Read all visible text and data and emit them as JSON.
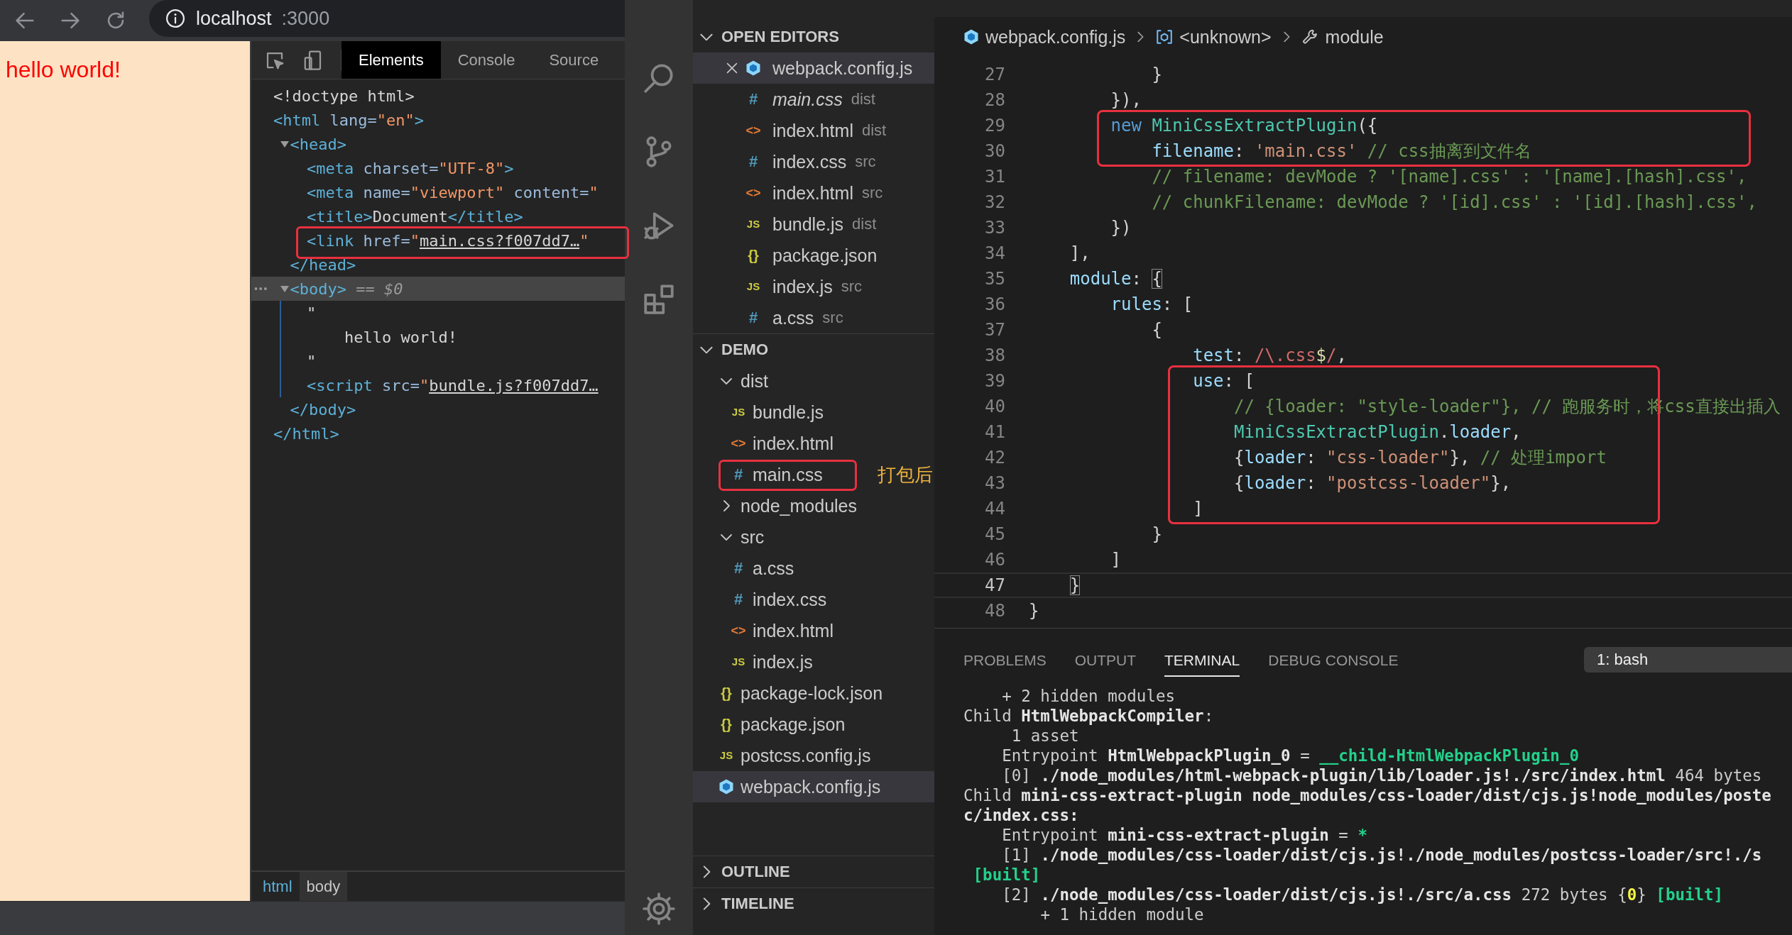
{
  "browser": {
    "address": {
      "host": "localhost",
      "port": ":3000"
    },
    "page_text": "hello world!",
    "devtools": {
      "tabs": [
        {
          "label": "Elements",
          "selected": true
        },
        {
          "label": "Console",
          "selected": false
        },
        {
          "label": "Source",
          "selected": false
        }
      ],
      "tree": [
        {
          "selected": false,
          "framed": false,
          "open": [
            {
              "kind": "plain",
              "text": "<!doctype html>"
            }
          ]
        },
        {
          "selected": false,
          "framed": false,
          "open": [
            {
              "kind": "tag",
              "text": "<html"
            },
            {
              "kind": "attr",
              "text": " lang="
            },
            {
              "kind": "value",
              "text": "\"en\""
            },
            {
              "kind": "tag",
              "text": ">"
            }
          ],
          "children": [
            {
              "selected": false,
              "framed": false,
              "expanded": true,
              "open": [
                {
                  "kind": "tag",
                  "text": "<head>"
                }
              ],
              "children": [
                {
                  "selected": false,
                  "framed": false,
                  "open": [
                    {
                      "kind": "tag",
                      "text": "<meta"
                    },
                    {
                      "kind": "attr",
                      "text": " charset="
                    },
                    {
                      "kind": "value",
                      "text": "\"UTF-8\""
                    },
                    {
                      "kind": "tag",
                      "text": ">"
                    }
                  ]
                },
                {
                  "selected": false,
                  "framed": false,
                  "open": [
                    {
                      "kind": "tag",
                      "text": "<meta"
                    },
                    {
                      "kind": "attr",
                      "text": " name="
                    },
                    {
                      "kind": "value",
                      "text": "\"viewport\""
                    },
                    {
                      "kind": "attr",
                      "text": " content="
                    },
                    {
                      "kind": "value",
                      "text": "\""
                    }
                  ]
                },
                {
                  "selected": false,
                  "framed": false,
                  "open": [
                    {
                      "kind": "tag",
                      "text": "<title>"
                    },
                    {
                      "kind": "plain",
                      "text": "Document"
                    },
                    {
                      "kind": "tag",
                      "text": "</title>"
                    }
                  ]
                },
                {
                  "selected": false,
                  "framed": true,
                  "open": [
                    {
                      "kind": "tag",
                      "text": "<link"
                    },
                    {
                      "kind": "attr",
                      "text": " href="
                    },
                    {
                      "kind": "value",
                      "text": "\""
                    },
                    {
                      "kind": "url",
                      "text": "main.css?f007dd7…"
                    },
                    {
                      "kind": "value",
                      "text": "\""
                    }
                  ]
                }
              ],
              "close": [
                {
                  "kind": "tag",
                  "text": "</head>"
                }
              ]
            },
            {
              "selected": true,
              "framed": false,
              "expanded": true,
              "open": [
                {
                  "kind": "tag",
                  "text": "<body>"
                },
                {
                  "kind": "hint",
                  "text": " == "
                },
                {
                  "kind": "var",
                  "text": "$0"
                }
              ],
              "children": [
                {
                  "selected": false,
                  "framed": false,
                  "lines": [
                    "\"",
                    "    hello world!",
                    "\""
                  ]
                },
                {
                  "selected": false,
                  "framed": false,
                  "open": [
                    {
                      "kind": "tag",
                      "text": "<script"
                    },
                    {
                      "kind": "attr",
                      "text": " src="
                    },
                    {
                      "kind": "value",
                      "text": "\""
                    },
                    {
                      "kind": "url",
                      "text": "bundle.js?f007dd7…"
                    }
                  ]
                }
              ],
              "close": [
                {
                  "kind": "tag",
                  "text": "</body>"
                }
              ]
            }
          ],
          "close": [
            {
              "kind": "tag",
              "text": "</html>"
            }
          ]
        }
      ],
      "breadcrumbs": [
        {
          "label": "html",
          "selected": false
        },
        {
          "label": "body",
          "selected": true
        }
      ]
    }
  },
  "explorer": {
    "sections": [
      {
        "title": "OPEN EDITORS",
        "expanded": true,
        "kind": "editors",
        "items": [
          {
            "kind": "webpack",
            "name": "webpack.config.js",
            "selected": true,
            "preview": false
          },
          {
            "kind": "css",
            "icon": "#",
            "name": "main.css",
            "detail": "dist",
            "selected": false,
            "preview": true
          },
          {
            "kind": "html",
            "icon": "<>",
            "name": "index.html",
            "detail": "dist",
            "selected": false,
            "preview": false
          },
          {
            "kind": "css",
            "icon": "#",
            "name": "index.css",
            "detail": "src",
            "selected": false,
            "preview": false
          },
          {
            "kind": "html",
            "icon": "<>",
            "name": "index.html",
            "detail": "src",
            "selected": false,
            "preview": false
          },
          {
            "kind": "js",
            "icon": "JS",
            "name": "bundle.js",
            "detail": "dist",
            "selected": false,
            "preview": false
          },
          {
            "kind": "json",
            "icon": "{}",
            "name": "package.json",
            "selected": false,
            "preview": false
          },
          {
            "kind": "js",
            "icon": "JS",
            "name": "index.js",
            "detail": "src",
            "selected": false,
            "preview": false
          },
          {
            "kind": "css",
            "icon": "#",
            "name": "a.css",
            "detail": "src",
            "selected": false,
            "preview": false
          }
        ]
      },
      {
        "title": "DEMO",
        "expanded": true,
        "kind": "tree",
        "items": [
          {
            "kind": "folder",
            "name": "dist",
            "expanded": true,
            "selected": false,
            "framed": false,
            "children": [
              {
                "kind": "js",
                "icon": "JS",
                "name": "bundle.js",
                "selected": false,
                "framed": false
              },
              {
                "kind": "html",
                "icon": "<>",
                "name": "index.html",
                "selected": false,
                "framed": false
              },
              {
                "kind": "css",
                "icon": "#",
                "name": "main.css",
                "selected": false,
                "framed": true,
                "note": "打包后"
              }
            ]
          },
          {
            "kind": "folder",
            "name": "node_modules",
            "expanded": false,
            "selected": false,
            "framed": false
          },
          {
            "kind": "folder",
            "name": "src",
            "expanded": true,
            "selected": false,
            "framed": false,
            "children": [
              {
                "kind": "css",
                "icon": "#",
                "name": "a.css",
                "selected": false,
                "framed": false
              },
              {
                "kind": "css",
                "icon": "#",
                "name": "index.css",
                "selected": false,
                "framed": false
              },
              {
                "kind": "html",
                "icon": "<>",
                "name": "index.html",
                "selected": false,
                "framed": false
              },
              {
                "kind": "js",
                "icon": "JS",
                "name": "index.js",
                "selected": false,
                "framed": false
              }
            ]
          },
          {
            "kind": "json",
            "icon": "{}",
            "name": "package-lock.json",
            "selected": false,
            "framed": false
          },
          {
            "kind": "json",
            "icon": "{}",
            "name": "package.json",
            "selected": false,
            "framed": false
          },
          {
            "kind": "js",
            "icon": "JS",
            "name": "postcss.config.js",
            "selected": false,
            "framed": false
          },
          {
            "kind": "webpack",
            "name": "webpack.config.js",
            "selected": true,
            "framed": false
          }
        ]
      },
      {
        "title": "OUTLINE",
        "expanded": false,
        "kind": "tree"
      },
      {
        "title": "TIMELINE",
        "expanded": false,
        "kind": "tree"
      }
    ]
  },
  "editor": {
    "breadcrumbs": [
      {
        "kind": "file",
        "label": "webpack.config.js"
      },
      {
        "kind": "symbol",
        "label": "<unknown>"
      },
      {
        "kind": "property",
        "label": "module"
      }
    ],
    "lines": [
      {
        "number": "27",
        "framed": false,
        "current": false,
        "tokens": [
          {
            "kind": "plain",
            "text": "            }"
          }
        ]
      },
      {
        "number": "28",
        "framed": false,
        "current": false,
        "tokens": [
          {
            "kind": "plain",
            "text": "        }),"
          }
        ]
      },
      {
        "number": "29",
        "framed": true,
        "current": false,
        "tokens": [
          {
            "kind": "keyword",
            "text": "        new "
          },
          {
            "kind": "class",
            "text": "MiniCssExtractPlugin"
          },
          {
            "kind": "plain",
            "text": "({"
          }
        ]
      },
      {
        "number": "30",
        "framed": true,
        "current": false,
        "tokens": [
          {
            "kind": "prop",
            "text": "            filename"
          },
          {
            "kind": "plain",
            "text": ": "
          },
          {
            "kind": "string",
            "text": "'main.css'"
          },
          {
            "kind": "comment",
            "text": " // css抽离到文件名"
          }
        ]
      },
      {
        "number": "31",
        "framed": false,
        "current": false,
        "tokens": [
          {
            "kind": "comment",
            "text": "            // filename: devMode ? '[name].css' : '[name].[hash].css',"
          }
        ]
      },
      {
        "number": "32",
        "framed": false,
        "current": false,
        "tokens": [
          {
            "kind": "comment",
            "text": "            // chunkFilename: devMode ? '[id].css' : '[id].[hash].css',"
          }
        ]
      },
      {
        "number": "33",
        "framed": false,
        "current": false,
        "tokens": [
          {
            "kind": "plain",
            "text": "        })"
          }
        ]
      },
      {
        "number": "34",
        "framed": false,
        "current": false,
        "tokens": [
          {
            "kind": "plain",
            "text": "    ],"
          }
        ]
      },
      {
        "number": "35",
        "framed": false,
        "current": false,
        "tokens": [
          {
            "kind": "prop",
            "text": "    module"
          },
          {
            "kind": "plain",
            "text": ": "
          },
          {
            "kind": "bracket",
            "text": "{"
          }
        ]
      },
      {
        "number": "36",
        "framed": false,
        "current": false,
        "tokens": [
          {
            "kind": "prop",
            "text": "        rules"
          },
          {
            "kind": "plain",
            "text": ": ["
          }
        ]
      },
      {
        "number": "37",
        "framed": false,
        "current": false,
        "tokens": [
          {
            "kind": "plain",
            "text": "            {"
          }
        ]
      },
      {
        "number": "38",
        "framed": false,
        "current": false,
        "tokens": [
          {
            "kind": "prop",
            "text": "                test"
          },
          {
            "kind": "plain",
            "text": ": "
          },
          {
            "kind": "regex",
            "text": "/\\.css"
          },
          {
            "kind": "anchor",
            "text": "$"
          },
          {
            "kind": "regex",
            "text": "/"
          },
          {
            "kind": "plain",
            "text": ","
          }
        ]
      },
      {
        "number": "39",
        "framed": true,
        "current": false,
        "tokens": [
          {
            "kind": "prop",
            "text": "                use"
          },
          {
            "kind": "plain",
            "text": ": ["
          }
        ]
      },
      {
        "number": "40",
        "framed": true,
        "current": false,
        "tokens": [
          {
            "kind": "comment",
            "text": "                    // {loader: \"style-loader\"}, // 跑服务时，将css直接出插入"
          }
        ]
      },
      {
        "number": "41",
        "framed": true,
        "current": false,
        "tokens": [
          {
            "kind": "class",
            "text": "                    MiniCssExtractPlugin"
          },
          {
            "kind": "plain",
            "text": "."
          },
          {
            "kind": "prop",
            "text": "loader"
          },
          {
            "kind": "plain",
            "text": ","
          }
        ]
      },
      {
        "number": "42",
        "framed": true,
        "current": false,
        "tokens": [
          {
            "kind": "plain",
            "text": "                    {"
          },
          {
            "kind": "prop",
            "text": "loader"
          },
          {
            "kind": "plain",
            "text": ": "
          },
          {
            "kind": "string",
            "text": "\"css-loader\""
          },
          {
            "kind": "plain",
            "text": "}, "
          },
          {
            "kind": "comment",
            "text": "// 处理import"
          }
        ]
      },
      {
        "number": "43",
        "framed": true,
        "current": false,
        "tokens": [
          {
            "kind": "plain",
            "text": "                    {"
          },
          {
            "kind": "prop",
            "text": "loader"
          },
          {
            "kind": "plain",
            "text": ": "
          },
          {
            "kind": "string",
            "text": "\"postcss-loader\""
          },
          {
            "kind": "plain",
            "text": "},"
          }
        ]
      },
      {
        "number": "44",
        "framed": true,
        "current": false,
        "tokens": [
          {
            "kind": "plain",
            "text": "                ]"
          }
        ]
      },
      {
        "number": "45",
        "framed": false,
        "current": false,
        "tokens": [
          {
            "kind": "plain",
            "text": "            }"
          }
        ]
      },
      {
        "number": "46",
        "framed": false,
        "current": false,
        "tokens": [
          {
            "kind": "plain",
            "text": "        ]"
          }
        ]
      },
      {
        "number": "47",
        "framed": false,
        "current": true,
        "tokens": [
          {
            "kind": "bracket",
            "text": "    }"
          }
        ]
      },
      {
        "number": "48",
        "framed": false,
        "current": false,
        "tokens": [
          {
            "kind": "plain",
            "text": "}"
          }
        ]
      }
    ]
  },
  "panel": {
    "tabs": [
      {
        "label": "PROBLEMS",
        "selected": false
      },
      {
        "label": "OUTPUT",
        "selected": false
      },
      {
        "label": "TERMINAL",
        "selected": true
      },
      {
        "label": "DEBUG CONSOLE",
        "selected": false
      }
    ],
    "terminal_selector": "1: bash",
    "terminal_lines": [
      {
        "tokens": [
          {
            "kind": "plain",
            "text": "    + 2 hidden modules"
          }
        ]
      },
      {
        "tokens": [
          {
            "kind": "plain",
            "text": "Child "
          },
          {
            "kind": "bold",
            "text": "HtmlWebpackCompiler"
          },
          {
            "kind": "plain",
            "text": ":"
          }
        ]
      },
      {
        "tokens": [
          {
            "kind": "plain",
            "text": "     1 asset"
          }
        ]
      },
      {
        "tokens": [
          {
            "kind": "plain",
            "text": "    Entrypoint "
          },
          {
            "kind": "bold",
            "text": "HtmlWebpackPlugin_0"
          },
          {
            "kind": "plain",
            "text": " = "
          },
          {
            "kind": "green",
            "text": "__child-HtmlWebpackPlugin_0"
          }
        ]
      },
      {
        "tokens": [
          {
            "kind": "plain",
            "text": "    [0] "
          },
          {
            "kind": "bold",
            "text": "./node_modules/html-webpack-plugin/lib/loader.js!./src/index.html"
          },
          {
            "kind": "plain",
            "text": " 464 bytes"
          }
        ]
      },
      {
        "tokens": [
          {
            "kind": "plain",
            "text": "Child "
          },
          {
            "kind": "bold",
            "text": "mini-css-extract-plugin node_modules/css-loader/dist/cjs.js!node_modules/poste"
          }
        ]
      },
      {
        "tokens": [
          {
            "kind": "bold",
            "text": "c/index.css:"
          }
        ]
      },
      {
        "tokens": [
          {
            "kind": "plain",
            "text": "    Entrypoint "
          },
          {
            "kind": "bold",
            "text": "mini-css-extract-plugin"
          },
          {
            "kind": "plain",
            "text": " = "
          },
          {
            "kind": "green",
            "text": "*"
          }
        ]
      },
      {
        "tokens": [
          {
            "kind": "plain",
            "text": "    [1] "
          },
          {
            "kind": "bold",
            "text": "./node_modules/css-loader/dist/cjs.js!./node_modules/postcss-loader/src!./s"
          }
        ]
      },
      {
        "tokens": [
          {
            "kind": "green",
            "text": " [built]"
          }
        ]
      },
      {
        "tokens": [
          {
            "kind": "plain",
            "text": "    [2] "
          },
          {
            "kind": "bold",
            "text": "./node_modules/css-loader/dist/cjs.js!./src/a.css"
          },
          {
            "kind": "plain",
            "text": " 272 bytes {"
          },
          {
            "kind": "yellow",
            "text": "0"
          },
          {
            "kind": "plain",
            "text": "} "
          },
          {
            "kind": "green",
            "text": "[built]"
          }
        ]
      },
      {
        "tokens": [
          {
            "kind": "plain",
            "text": "        + 1 hidden module"
          }
        ]
      }
    ]
  }
}
